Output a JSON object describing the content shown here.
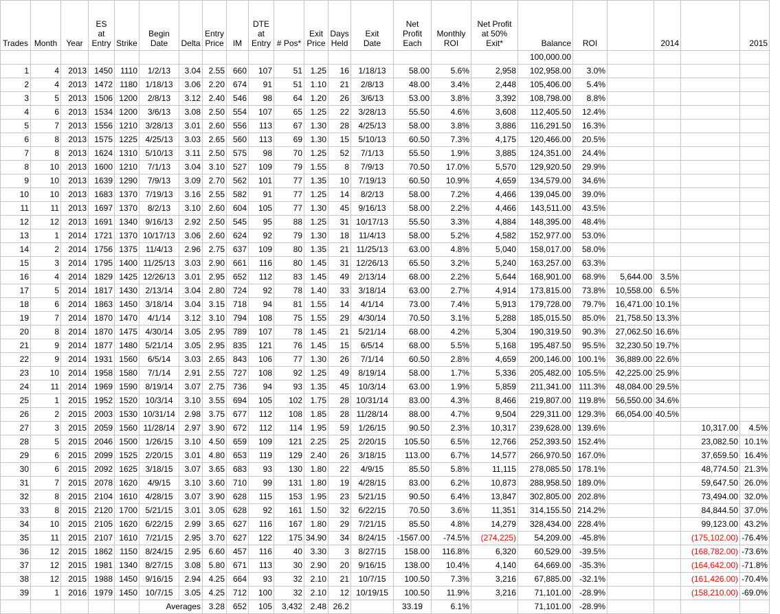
{
  "headers": [
    [
      "Trades"
    ],
    [
      "Month"
    ],
    [
      "Year"
    ],
    [
      "ES",
      "at",
      "Entry"
    ],
    [
      "Strike"
    ],
    [
      "Begin",
      "Date"
    ],
    [
      "Delta"
    ],
    [
      "Entry",
      "Price"
    ],
    [
      "IM"
    ],
    [
      "DTE",
      "at",
      "Entry"
    ],
    [
      "# Pos*"
    ],
    [
      "Exit",
      "Price"
    ],
    [
      "Days",
      "Held"
    ],
    [
      "Exit",
      "Date"
    ],
    [
      "Net",
      "Profit",
      "Each"
    ],
    [
      "Monthly",
      "ROI"
    ],
    [
      "Net Profit",
      "at 50%",
      "Exit*"
    ],
    [
      "Balance"
    ],
    [
      "ROI"
    ],
    [
      ""
    ],
    [
      "2014"
    ],
    [
      ""
    ],
    [
      "2015"
    ]
  ],
  "starting_balance": "100,000.00",
  "rows": [
    [
      "1",
      "4",
      "2013",
      "1450",
      "1110",
      "1/2/13",
      "3.04",
      "2.55",
      "660",
      "107",
      "51",
      "1.25",
      "16",
      "1/18/13",
      "58.00",
      "5.6%",
      "2,958",
      "102,958.00",
      "3.0%",
      "",
      "",
      "",
      ""
    ],
    [
      "2",
      "4",
      "2013",
      "1472",
      "1180",
      "1/18/13",
      "3.06",
      "2.20",
      "674",
      "91",
      "51",
      "1.10",
      "21",
      "2/8/13",
      "48.00",
      "3.4%",
      "2,448",
      "105,406.00",
      "5.4%",
      "",
      "",
      "",
      ""
    ],
    [
      "3",
      "5",
      "2013",
      "1506",
      "1200",
      "2/8/13",
      "3.12",
      "2.40",
      "546",
      "98",
      "64",
      "1.20",
      "26",
      "3/6/13",
      "53.00",
      "3.8%",
      "3,392",
      "108,798.00",
      "8.8%",
      "",
      "",
      "",
      ""
    ],
    [
      "4",
      "6",
      "2013",
      "1534",
      "1200",
      "3/6/13",
      "3.08",
      "2.50",
      "554",
      "107",
      "65",
      "1.25",
      "22",
      "3/28/13",
      "55.50",
      "4.6%",
      "3,608",
      "112,405.50",
      "12.4%",
      "",
      "",
      "",
      ""
    ],
    [
      "5",
      "7",
      "2013",
      "1556",
      "1210",
      "3/28/13",
      "3.01",
      "2.60",
      "556",
      "113",
      "67",
      "1.30",
      "28",
      "4/25/13",
      "58.00",
      "3.8%",
      "3,886",
      "116,291.50",
      "16.3%",
      "",
      "",
      "",
      ""
    ],
    [
      "6",
      "8",
      "2013",
      "1575",
      "1225",
      "4/25/13",
      "3.03",
      "2.65",
      "560",
      "113",
      "69",
      "1.30",
      "15",
      "5/10/13",
      "60.50",
      "7.3%",
      "4,175",
      "120,466.00",
      "20.5%",
      "",
      "",
      "",
      ""
    ],
    [
      "7",
      "8",
      "2013",
      "1624",
      "1310",
      "5/10/13",
      "3.11",
      "2.50",
      "575",
      "98",
      "70",
      "1.25",
      "52",
      "7/1/13",
      "55.50",
      "1.9%",
      "3,885",
      "124,351.00",
      "24.4%",
      "",
      "",
      "",
      ""
    ],
    [
      "8",
      "10",
      "2013",
      "1600",
      "1210",
      "7/1/13",
      "3.04",
      "3.10",
      "527",
      "109",
      "79",
      "1.55",
      "8",
      "7/9/13",
      "70.50",
      "17.0%",
      "5,570",
      "129,920.50",
      "29.9%",
      "",
      "",
      "",
      ""
    ],
    [
      "9",
      "10",
      "2013",
      "1639",
      "1290",
      "7/9/13",
      "3.09",
      "2.70",
      "562",
      "101",
      "77",
      "1.35",
      "10",
      "7/19/13",
      "60.50",
      "10.9%",
      "4,659",
      "134,579.00",
      "34.6%",
      "",
      "",
      "",
      ""
    ],
    [
      "10",
      "10",
      "2013",
      "1683",
      "1370",
      "7/19/13",
      "3.16",
      "2.55",
      "582",
      "91",
      "77",
      "1.25",
      "14",
      "8/2/13",
      "58.00",
      "7.2%",
      "4,466",
      "139,045.00",
      "39.0%",
      "",
      "",
      "",
      ""
    ],
    [
      "11",
      "11",
      "2013",
      "1697",
      "1370",
      "8/2/13",
      "3.10",
      "2.60",
      "604",
      "105",
      "77",
      "1.30",
      "45",
      "9/16/13",
      "58.00",
      "2.2%",
      "4,466",
      "143,511.00",
      "43.5%",
      "",
      "",
      "",
      ""
    ],
    [
      "12",
      "12",
      "2013",
      "1691",
      "1340",
      "9/16/13",
      "2.92",
      "2.50",
      "545",
      "95",
      "88",
      "1.25",
      "31",
      "10/17/13",
      "55.50",
      "3.3%",
      "4,884",
      "148,395.00",
      "48.4%",
      "",
      "",
      "",
      ""
    ],
    [
      "13",
      "1",
      "2014",
      "1721",
      "1370",
      "10/17/13",
      "3.06",
      "2.60",
      "624",
      "92",
      "79",
      "1.30",
      "18",
      "11/4/13",
      "58.00",
      "5.2%",
      "4,582",
      "152,977.00",
      "53.0%",
      "",
      "",
      "",
      ""
    ],
    [
      "14",
      "2",
      "2014",
      "1756",
      "1375",
      "11/4/13",
      "2.96",
      "2.75",
      "637",
      "109",
      "80",
      "1.35",
      "21",
      "11/25/13",
      "63.00",
      "4.8%",
      "5,040",
      "158,017.00",
      "58.0%",
      "",
      "",
      "",
      ""
    ],
    [
      "15",
      "3",
      "2014",
      "1795",
      "1400",
      "11/25/13",
      "3.03",
      "2.90",
      "661",
      "116",
      "80",
      "1.45",
      "31",
      "12/26/13",
      "65.50",
      "3.2%",
      "5,240",
      "163,257.00",
      "63.3%",
      "",
      "",
      "",
      ""
    ],
    [
      "16",
      "4",
      "2014",
      "1829",
      "1425",
      "12/26/13",
      "3.01",
      "2.95",
      "652",
      "112",
      "83",
      "1.45",
      "49",
      "2/13/14",
      "68.00",
      "2.2%",
      "5,644",
      "168,901.00",
      "68.9%",
      "5,644.00",
      "3.5%",
      "",
      ""
    ],
    [
      "17",
      "5",
      "2014",
      "1817",
      "1430",
      "2/13/14",
      "3.04",
      "2.80",
      "724",
      "92",
      "78",
      "1.40",
      "33",
      "3/18/14",
      "63.00",
      "2.7%",
      "4,914",
      "173,815.00",
      "73.8%",
      "10,558.00",
      "6.5%",
      "",
      ""
    ],
    [
      "18",
      "6",
      "2014",
      "1863",
      "1450",
      "3/18/14",
      "3.04",
      "3.15",
      "718",
      "94",
      "81",
      "1.55",
      "14",
      "4/1/14",
      "73.00",
      "7.4%",
      "5,913",
      "179,728.00",
      "79.7%",
      "16,471.00",
      "10.1%",
      "",
      ""
    ],
    [
      "19",
      "7",
      "2014",
      "1870",
      "1470",
      "4/1/14",
      "3.12",
      "3.10",
      "794",
      "108",
      "75",
      "1.55",
      "29",
      "4/30/14",
      "70.50",
      "3.1%",
      "5,288",
      "185,015.50",
      "85.0%",
      "21,758.50",
      "13.3%",
      "",
      ""
    ],
    [
      "20",
      "8",
      "2014",
      "1870",
      "1475",
      "4/30/14",
      "3.05",
      "2.95",
      "789",
      "107",
      "78",
      "1.45",
      "21",
      "5/21/14",
      "68.00",
      "4.2%",
      "5,304",
      "190,319.50",
      "90.3%",
      "27,062.50",
      "16.6%",
      "",
      ""
    ],
    [
      "21",
      "9",
      "2014",
      "1877",
      "1480",
      "5/21/14",
      "3.05",
      "2.95",
      "835",
      "121",
      "76",
      "1.45",
      "15",
      "6/5/14",
      "68.00",
      "5.5%",
      "5,168",
      "195,487.50",
      "95.5%",
      "32,230.50",
      "19.7%",
      "",
      ""
    ],
    [
      "22",
      "9",
      "2014",
      "1931",
      "1560",
      "6/5/14",
      "3.03",
      "2.65",
      "843",
      "106",
      "77",
      "1.30",
      "26",
      "7/1/14",
      "60.50",
      "2.8%",
      "4,659",
      "200,146.00",
      "100.1%",
      "36,889.00",
      "22.6%",
      "",
      ""
    ],
    [
      "23",
      "10",
      "2014",
      "1958",
      "1580",
      "7/1/14",
      "2.91",
      "2.55",
      "727",
      "108",
      "92",
      "1.25",
      "49",
      "8/19/14",
      "58.00",
      "1.7%",
      "5,336",
      "205,482.00",
      "105.5%",
      "42,225.00",
      "25.9%",
      "",
      ""
    ],
    [
      "24",
      "11",
      "2014",
      "1969",
      "1590",
      "8/19/14",
      "3.07",
      "2.75",
      "736",
      "94",
      "93",
      "1.35",
      "45",
      "10/3/14",
      "63.00",
      "1.9%",
      "5,859",
      "211,341.00",
      "111.3%",
      "48,084.00",
      "29.5%",
      "",
      ""
    ],
    [
      "25",
      "1",
      "2015",
      "1952",
      "1520",
      "10/3/14",
      "3.10",
      "3.55",
      "694",
      "105",
      "102",
      "1.75",
      "28",
      "10/31/14",
      "83.00",
      "4.3%",
      "8,466",
      "219,807.00",
      "119.8%",
      "56,550.00",
      "34.6%",
      "",
      ""
    ],
    [
      "26",
      "2",
      "2015",
      "2003",
      "1530",
      "10/31/14",
      "2.98",
      "3.75",
      "677",
      "112",
      "108",
      "1.85",
      "28",
      "11/28/14",
      "88.00",
      "4.7%",
      "9,504",
      "229,311.00",
      "129.3%",
      "66,054.00",
      "40.5%",
      "",
      ""
    ],
    [
      "27",
      "3",
      "2015",
      "2059",
      "1560",
      "11/28/14",
      "2.97",
      "3.90",
      "672",
      "112",
      "114",
      "1.95",
      "59",
      "1/26/15",
      "90.50",
      "2.3%",
      "10,317",
      "239,628.00",
      "139.6%",
      "",
      "",
      "10,317.00",
      "4.5%"
    ],
    [
      "28",
      "5",
      "2015",
      "2046",
      "1500",
      "1/26/15",
      "3.10",
      "4.50",
      "659",
      "109",
      "121",
      "2.25",
      "25",
      "2/20/15",
      "105.50",
      "6.5%",
      "12,766",
      "252,393.50",
      "152.4%",
      "",
      "",
      "23,082.50",
      "10.1%"
    ],
    [
      "29",
      "6",
      "2015",
      "2099",
      "1525",
      "2/20/15",
      "3.01",
      "4.80",
      "653",
      "119",
      "129",
      "2.40",
      "26",
      "3/18/15",
      "113.00",
      "6.7%",
      "14,577",
      "266,970.50",
      "167.0%",
      "",
      "",
      "37,659.50",
      "16.4%"
    ],
    [
      "30",
      "6",
      "2015",
      "2092",
      "1625",
      "3/18/15",
      "3.07",
      "3.65",
      "683",
      "93",
      "130",
      "1.80",
      "22",
      "4/9/15",
      "85.50",
      "5.8%",
      "11,115",
      "278,085.50",
      "178.1%",
      "",
      "",
      "48,774.50",
      "21.3%"
    ],
    [
      "31",
      "7",
      "2015",
      "2078",
      "1620",
      "4/9/15",
      "3.10",
      "3.60",
      "710",
      "99",
      "131",
      "1.80",
      "19",
      "4/28/15",
      "83.00",
      "6.2%",
      "10,873",
      "288,958.50",
      "189.0%",
      "",
      "",
      "59,647.50",
      "26.0%"
    ],
    [
      "32",
      "8",
      "2015",
      "2104",
      "1610",
      "4/28/15",
      "3.07",
      "3.90",
      "628",
      "115",
      "153",
      "1.95",
      "23",
      "5/21/15",
      "90.50",
      "6.4%",
      "13,847",
      "302,805.00",
      "202.8%",
      "",
      "",
      "73,494.00",
      "32.0%"
    ],
    [
      "33",
      "8",
      "2015",
      "2120",
      "1700",
      "5/21/15",
      "3.01",
      "3.05",
      "628",
      "92",
      "161",
      "1.50",
      "32",
      "6/22/15",
      "70.50",
      "3.6%",
      "11,351",
      "314,155.50",
      "214.2%",
      "",
      "",
      "84,844.50",
      "37.0%"
    ],
    [
      "34",
      "10",
      "2015",
      "2105",
      "1620",
      "6/22/15",
      "2.99",
      "3.65",
      "627",
      "116",
      "167",
      "1.80",
      "29",
      "7/21/15",
      "85.50",
      "4.8%",
      "14,279",
      "328,434.00",
      "228.4%",
      "",
      "",
      "99,123.00",
      "43.2%"
    ],
    [
      "35",
      "11",
      "2015",
      "2107",
      "1610",
      "7/21/15",
      "2.95",
      "3.70",
      "627",
      "122",
      "175",
      "34.90",
      "34",
      "8/24/15",
      "-1567.00",
      "-74.5%",
      "(274,225)",
      "54,209.00",
      "-45.8%",
      "",
      "",
      "(175,102.00)",
      "-76.4%"
    ],
    [
      "36",
      "12",
      "2015",
      "1862",
      "1150",
      "8/24/15",
      "2.95",
      "6.60",
      "457",
      "116",
      "40",
      "3.30",
      "3",
      "8/27/15",
      "158.00",
      "116.8%",
      "6,320",
      "60,529.00",
      "-39.5%",
      "",
      "",
      "(168,782.00)",
      "-73.6%"
    ],
    [
      "37",
      "12",
      "2015",
      "1981",
      "1340",
      "8/27/15",
      "3.08",
      "5.80",
      "671",
      "113",
      "30",
      "2.90",
      "20",
      "9/16/15",
      "138.00",
      "10.4%",
      "4,140",
      "64,669.00",
      "-35.3%",
      "",
      "",
      "(164,642.00)",
      "-71.8%"
    ],
    [
      "38",
      "12",
      "2015",
      "1988",
      "1450",
      "9/16/15",
      "2.94",
      "4.25",
      "664",
      "93",
      "32",
      "2.10",
      "21",
      "10/7/15",
      "100.50",
      "7.3%",
      "3,216",
      "67,885.00",
      "-32.1%",
      "",
      "",
      "(161,426.00)",
      "-70.4%"
    ],
    [
      "39",
      "1",
      "2016",
      "1979",
      "1450",
      "10/7/15",
      "3.05",
      "4.25",
      "712",
      "100",
      "32",
      "2.10",
      "12",
      "10/19/15",
      "100.50",
      "11.9%",
      "3,216",
      "71,101.00",
      "-28.9%",
      "",
      "",
      "(158,210.00)",
      "-69.0%"
    ]
  ],
  "averages": {
    "label": "Averages",
    "delta": "3.28",
    "im": "652",
    "dte": "105",
    "pos": "3,432",
    "exit_price": "2.48",
    "days_held": "26.2",
    "net_profit": "33.19",
    "monthly_roi": "6.1%",
    "balance": "71,101.00",
    "roi": "-28.9%"
  },
  "colors": {
    "negative": "#ff0000",
    "grid": "#c6c6c6"
  }
}
